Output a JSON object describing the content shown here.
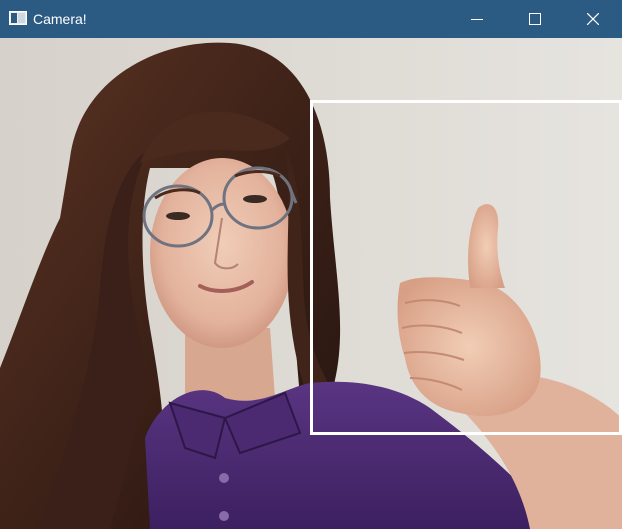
{
  "window": {
    "title": "Camera!",
    "titlebar_color": "#2b5a82",
    "controls": {
      "minimize_icon": "minimize-icon",
      "maximize_icon": "maximize-icon",
      "close_icon": "close-icon"
    }
  },
  "camera_feed": {
    "description_color_wall": "#dcd8d2",
    "shirt_color": "#4a2a70",
    "detection_box_color": "#ffffff"
  }
}
